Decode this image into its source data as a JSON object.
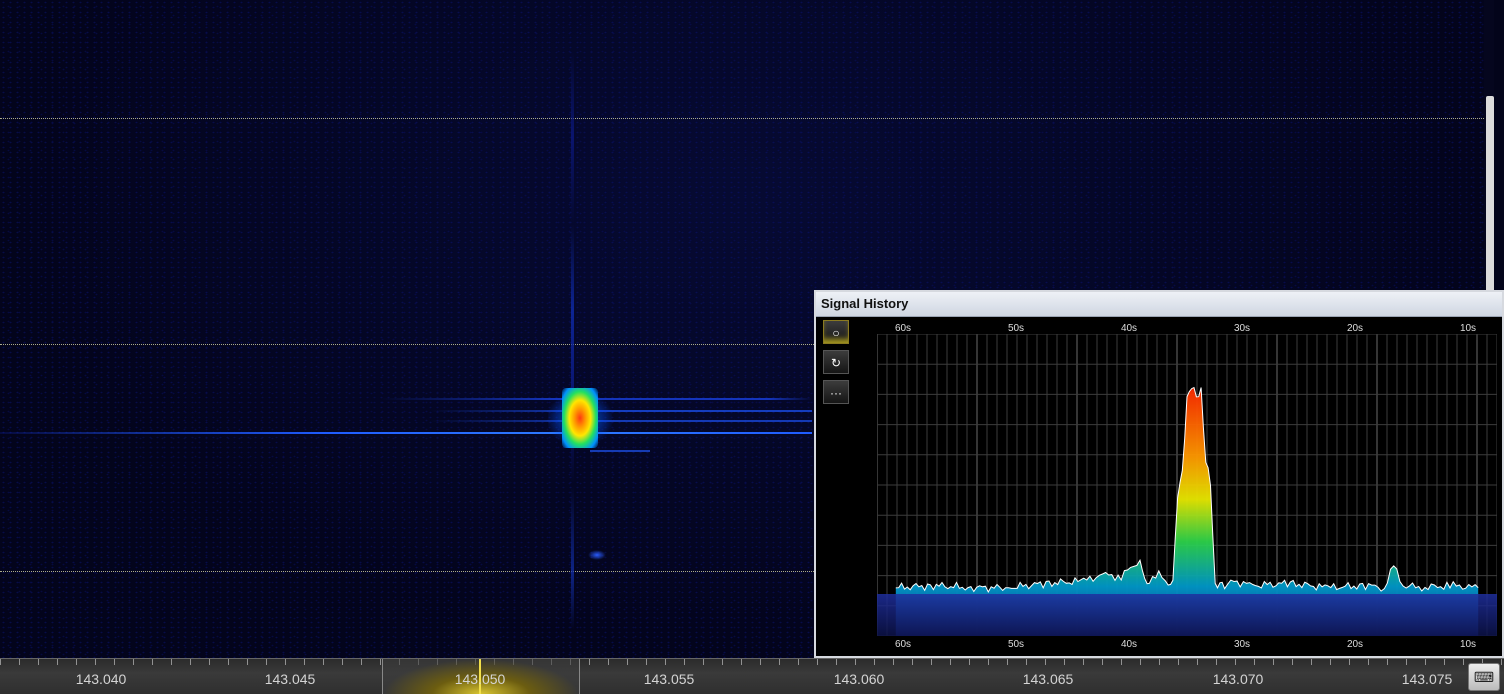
{
  "frequency_ruler": {
    "labels": [
      "143.040",
      "143.045",
      "143.050",
      "143.055",
      "143.060",
      "143.065",
      "143.070",
      "143.075"
    ],
    "selected_label": "143.050"
  },
  "signal_history": {
    "title": "Signal History",
    "tools": [
      {
        "icon": "record-circle-icon",
        "glyph": "○"
      },
      {
        "icon": "refresh-icon",
        "glyph": "↻"
      },
      {
        "icon": "more-icon",
        "glyph": "···"
      }
    ],
    "time_labels": [
      "60s",
      "50s",
      "40s",
      "30s",
      "20s",
      "10s"
    ]
  },
  "keyboard_button": {
    "icon": "keyboard-icon",
    "glyph": "⌨"
  },
  "colors": {
    "trace": "#ffffff",
    "grid": "#4a4a4a",
    "vfo": "#f2e04a"
  },
  "chart_data": {
    "type": "area",
    "x_axis": "seconds ago",
    "x_ticks": [
      "60s",
      "50s",
      "40s",
      "30s",
      "20s",
      "10s"
    ],
    "x": [
      64,
      60,
      56,
      52,
      48,
      44,
      42,
      40,
      38,
      37.5,
      37,
      36,
      35,
      34.5,
      34,
      33.5,
      33,
      32.5,
      32,
      31.5,
      31,
      30.5,
      30,
      29.5,
      29,
      28,
      26,
      22,
      18,
      14,
      12,
      11,
      10,
      8,
      5,
      2
    ],
    "values": [
      0.02,
      0.03,
      0.02,
      0.02,
      0.04,
      0.05,
      0.08,
      0.07,
      0.15,
      0.06,
      0.04,
      0.1,
      0.02,
      0.05,
      0.45,
      0.55,
      0.88,
      0.95,
      0.9,
      0.92,
      0.6,
      0.5,
      0.03,
      0.04,
      0.02,
      0.05,
      0.03,
      0.04,
      0.02,
      0.03,
      0.02,
      0.12,
      0.03,
      0.02,
      0.03,
      0.02
    ],
    "ylim": [
      0,
      1
    ],
    "grid": true
  }
}
